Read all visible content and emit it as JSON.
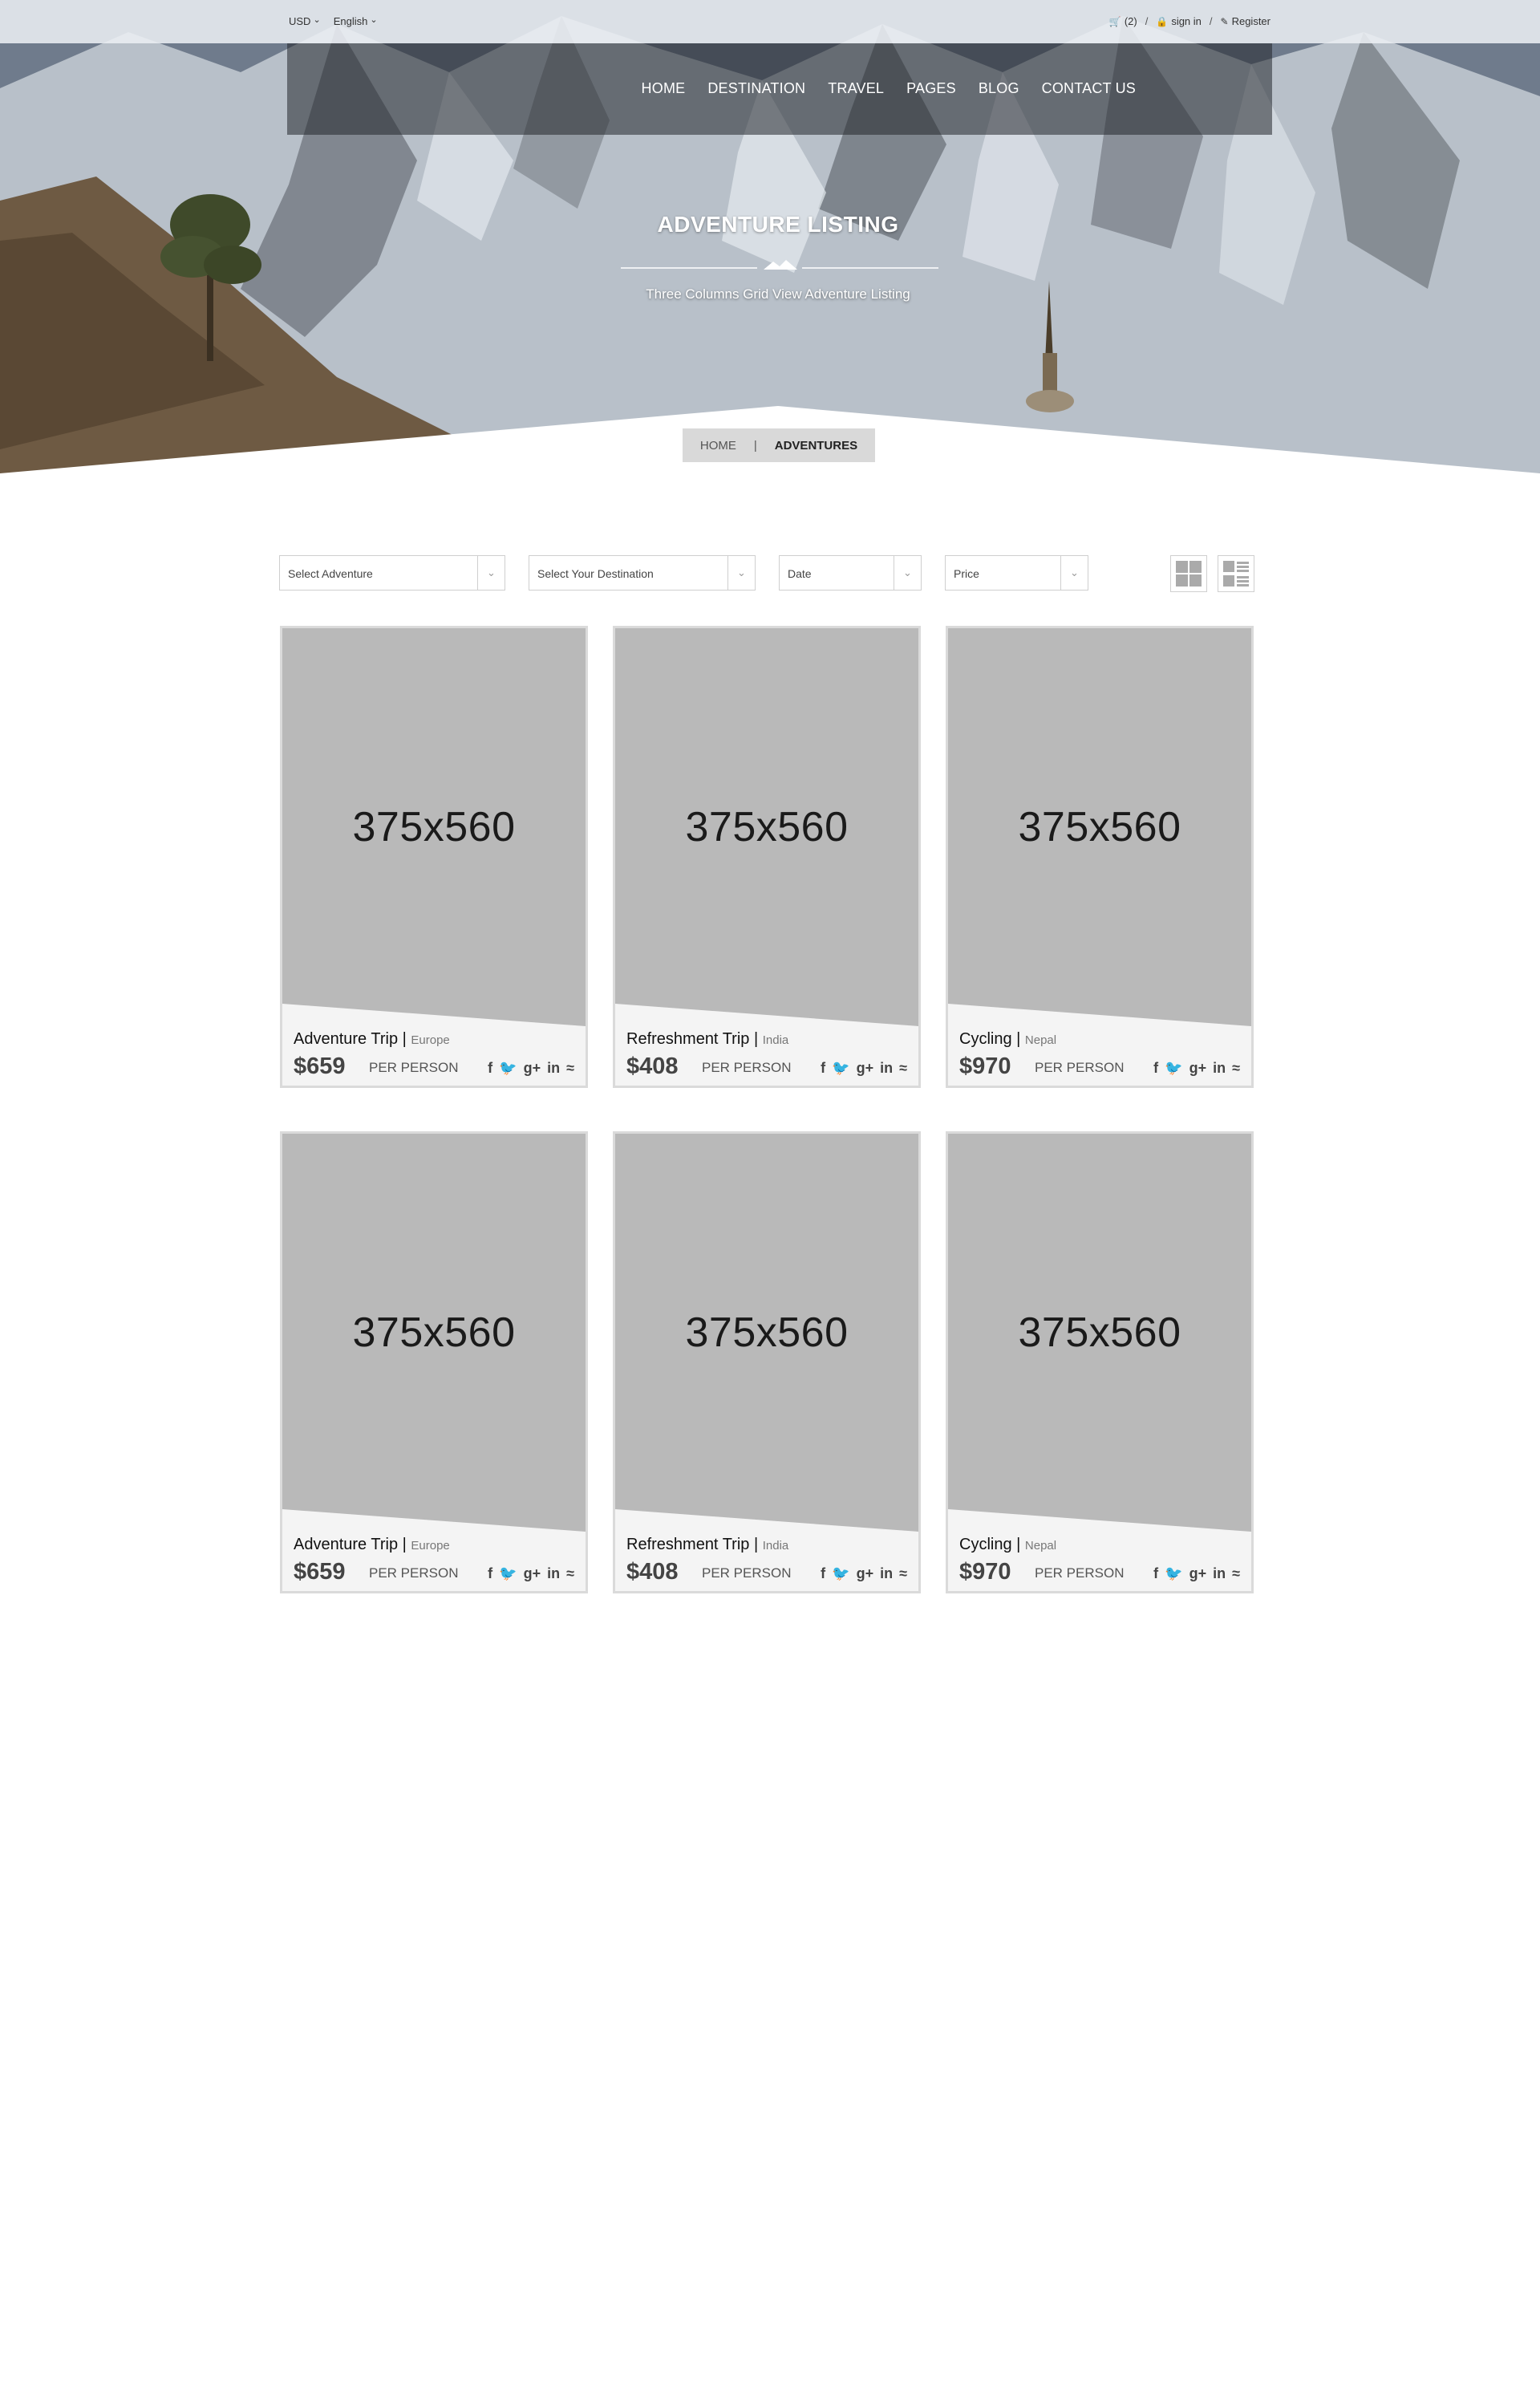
{
  "topbar": {
    "currency": "USD",
    "language": "English",
    "cart_icon": "cart-icon",
    "cart_count": "(2)",
    "lock_icon": "lock-icon",
    "sign_in": "sign in",
    "register_icon": "edit-icon",
    "register": "Register"
  },
  "nav": {
    "items": [
      {
        "label": "HOME"
      },
      {
        "label": "DESTINATION"
      },
      {
        "label": "TRAVEL"
      },
      {
        "label": "PAGES"
      },
      {
        "label": "BLOG"
      },
      {
        "label": "CONTACT US"
      }
    ]
  },
  "hero": {
    "title": "ADVENTURE LISTING",
    "subtitle": "Three Columns Grid View Adventure Listing"
  },
  "breadcrumb": {
    "home": "HOME",
    "separator": "|",
    "current": "ADVENTURES"
  },
  "filters": {
    "adventure": "Select Adventure",
    "destination": "Select Your Destination",
    "date": "Date",
    "price": "Price"
  },
  "cards": [
    {
      "image": "375x560",
      "title": "Adventure Trip",
      "sep": "|",
      "place": "Europe",
      "price": "$659",
      "per": "PER PERSON"
    },
    {
      "image": "375x560",
      "title": "Refreshment Trip",
      "sep": "|",
      "place": "India",
      "price": "$408",
      "per": "PER PERSON"
    },
    {
      "image": "375x560",
      "title": "Cycling",
      "sep": "|",
      "place": "Nepal",
      "price": "$970",
      "per": "PER PERSON"
    },
    {
      "image": "375x560",
      "title": "Adventure Trip",
      "sep": "|",
      "place": "Europe",
      "price": "$659",
      "per": "PER PERSON"
    },
    {
      "image": "375x560",
      "title": "Refreshment Trip",
      "sep": "|",
      "place": "India",
      "price": "$408",
      "per": "PER PERSON"
    },
    {
      "image": "375x560",
      "title": "Cycling",
      "sep": "|",
      "place": "Nepal",
      "price": "$970",
      "per": "PER PERSON"
    }
  ],
  "social": [
    "f",
    "g+",
    "in"
  ],
  "colors": {
    "placeholder": "#b9b9b9",
    "card_footer": "#f4f4f4",
    "breadcrumb_bg": "#d9d9d9"
  }
}
